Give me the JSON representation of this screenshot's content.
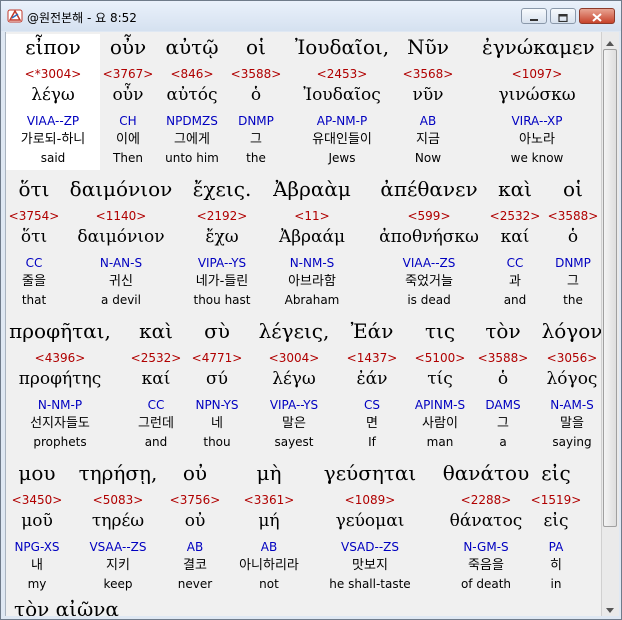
{
  "window": {
    "title": "@원전본해 - 요 8:52"
  },
  "rows": [
    [
      {
        "greek": "εἶπον",
        "strong": "<*3004>",
        "lexeme": "λέγω",
        "parsing": "VIAA--ZP",
        "korean": "가로되-하니",
        "english": "said"
      },
      {
        "greek": "οὖν",
        "strong": "<3767>",
        "lexeme": "οὖν",
        "parsing": "CH",
        "korean": "이에",
        "english": "Then"
      },
      {
        "greek": "αὐτῷ",
        "strong": "<846>",
        "lexeme": "αὐτός",
        "parsing": "NPDMZS",
        "korean": "그에게",
        "english": "unto him"
      },
      {
        "greek": "οἱ",
        "strong": "<3588>",
        "lexeme": "ὁ",
        "parsing": "DNMP",
        "korean": "그",
        "english": "the"
      },
      {
        "greek": "Ἰουδαῖοι,",
        "strong": "<2453>",
        "lexeme": "Ἰουδαῖος",
        "parsing": "AP-NM-P",
        "korean": "유대인들이",
        "english": "Jews"
      },
      {
        "greek": "Νῦν",
        "strong": "<3568>",
        "lexeme": "νῦν",
        "parsing": "AB",
        "korean": "지금",
        "english": "Now"
      },
      {
        "greek": "ἐγνώκαμεν",
        "strong": "<1097>",
        "lexeme": "γινώσκω",
        "parsing": "VIRA--XP",
        "korean": "아노라",
        "english": "we know"
      }
    ],
    [
      {
        "greek": "ὅτι",
        "strong": "<3754>",
        "lexeme": "ὅτι",
        "parsing": "CC",
        "korean": "줄을",
        "english": "that"
      },
      {
        "greek": "δαιμόνιον",
        "strong": "<1140>",
        "lexeme": "δαιμόνιον",
        "parsing": "N-AN-S",
        "korean": "귀신",
        "english": "a devil"
      },
      {
        "greek": "ἔχεις.",
        "strong": "<2192>",
        "lexeme": "ἔχω",
        "parsing": "VIPA--YS",
        "korean": "네가-들린",
        "english": "thou hast"
      },
      {
        "greek": "Ἀβραὰμ",
        "strong": "<11>",
        "lexeme": "Ἀβραάμ",
        "parsing": "N-NM-S",
        "korean": "아브라함",
        "english": "Abraham"
      },
      {
        "greek": "ἀπέθανεν",
        "strong": "<599>",
        "lexeme": "ἀποθνήσκω",
        "parsing": "VIAA--ZS",
        "korean": "죽었거늘",
        "english": "is dead"
      },
      {
        "greek": "καὶ",
        "strong": "<2532>",
        "lexeme": "καί",
        "parsing": "CC",
        "korean": "과",
        "english": "and"
      },
      {
        "greek": "οἱ",
        "strong": "<3588>",
        "lexeme": "ὁ",
        "parsing": "DNMP",
        "korean": "그",
        "english": "the"
      }
    ],
    [
      {
        "greek": "προφῆται,",
        "strong": "<4396>",
        "lexeme": "προφήτης",
        "parsing": "N-NM-P",
        "korean": "선지자들도",
        "english": "prophets"
      },
      {
        "greek": "καὶ",
        "strong": "<2532>",
        "lexeme": "καί",
        "parsing": "CC",
        "korean": "그런데",
        "english": "and"
      },
      {
        "greek": "σὺ",
        "strong": "<4771>",
        "lexeme": "σύ",
        "parsing": "NPN-YS",
        "korean": "네",
        "english": "thou"
      },
      {
        "greek": "λέγεις,",
        "strong": "<3004>",
        "lexeme": "λέγω",
        "parsing": "VIPA--YS",
        "korean": "말은",
        "english": "sayest"
      },
      {
        "greek": "Ἐάν",
        "strong": "<1437>",
        "lexeme": "ἐάν",
        "parsing": "CS",
        "korean": "면",
        "english": "If"
      },
      {
        "greek": "τις",
        "strong": "<5100>",
        "lexeme": "τίς",
        "parsing": "APINM-S",
        "korean": "사람이",
        "english": "man"
      },
      {
        "greek": "τὸν",
        "strong": "<3588>",
        "lexeme": "ὁ",
        "parsing": "DAMS",
        "korean": "그",
        "english": "a"
      },
      {
        "greek": "λόγον",
        "strong": "<3056>",
        "lexeme": "λόγος",
        "parsing": "N-AM-S",
        "korean": "말을",
        "english": "saying"
      }
    ],
    [
      {
        "greek": "μου",
        "strong": "<3450>",
        "lexeme": "μοῦ",
        "parsing": "NPG-XS",
        "korean": "내",
        "english": "my"
      },
      {
        "greek": "τηρήσῃ,",
        "strong": "<5083>",
        "lexeme": "τηρέω",
        "parsing": "VSAA--ZS",
        "korean": "지키",
        "english": "keep"
      },
      {
        "greek": "οὐ",
        "strong": "<3756>",
        "lexeme": "οὐ",
        "parsing": "AB",
        "korean": "결코",
        "english": "never"
      },
      {
        "greek": "μὴ",
        "strong": "<3361>",
        "lexeme": "μή",
        "parsing": "AB",
        "korean": "아니하리라",
        "english": "not"
      },
      {
        "greek": "γεύσηται",
        "strong": "<1089>",
        "lexeme": "γεύομαι",
        "parsing": "VSAD--ZS",
        "korean": "맛보지",
        "english": "he shall-taste"
      },
      {
        "greek": "θανάτου",
        "strong": "<2288>",
        "lexeme": "θάνατος",
        "parsing": "N-GM-S",
        "korean": "죽음을",
        "english": "of death"
      },
      {
        "greek": "εἰς",
        "strong": "<1519>",
        "lexeme": "εἰς",
        "parsing": "PA",
        "korean": "히",
        "english": "in"
      }
    ]
  ],
  "partial_line": "τὸν αἰῶνα"
}
